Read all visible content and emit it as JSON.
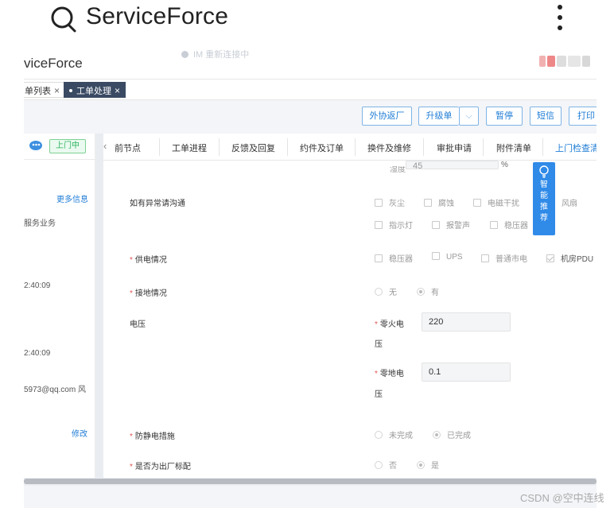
{
  "phone_header": {
    "title": "ServiceForce"
  },
  "app": {
    "title": "viceForce",
    "im_status": "IM 重新连接中"
  },
  "tabs": [
    {
      "label": "单列表",
      "close": "×"
    },
    {
      "label": "工单处理",
      "close": "×"
    }
  ],
  "toolbar": {
    "outsource": "外协返厂",
    "upgrade": "升级单",
    "upgrade_arrow": "⌵",
    "pause": "暂停",
    "sms": "短信",
    "print": "打印"
  },
  "left_panel": {
    "status": "上门中",
    "more_info": "更多信息",
    "service_type": "服务业务",
    "time1": "2:40:09",
    "time2": "2:40:09",
    "email": "5973@qq.com 风",
    "edit": "修改"
  },
  "nav_tabs": {
    "arrow": "‹",
    "items": [
      "前节点",
      "工单进程",
      "反馈及回复",
      "约件及订单",
      "换件及维修",
      "审批申请",
      "附件清单",
      "上门检查清"
    ]
  },
  "form": {
    "top_partial": {
      "label": "湿度",
      "value": "45",
      "unit": "%"
    },
    "abnormal": {
      "label": "如有异常请沟通",
      "options": [
        "灰尘",
        "腐蚀",
        "电磁干扰",
        "风扇",
        "指示灯",
        "报警声",
        "稳压器"
      ]
    },
    "power": {
      "label": "供电情况",
      "options": [
        "稳压器",
        "UPS",
        "普通市电",
        "机房PDU"
      ]
    },
    "ground": {
      "label": "接地情况",
      "options": [
        "无",
        "有"
      ]
    },
    "voltage": {
      "label": "电压",
      "fields": [
        {
          "label_a": "零火电",
          "label_b": "压",
          "value": "220"
        },
        {
          "label_a": "零地电",
          "label_b": "压",
          "value": "0.1"
        }
      ]
    },
    "antistatic": {
      "label": "防静电措施",
      "options": [
        "未完成",
        "已完成"
      ]
    },
    "factory": {
      "label": "是否为出厂标配",
      "options": [
        "否",
        "是"
      ]
    }
  },
  "smart": {
    "chars": [
      "智",
      "能",
      "推",
      "荐"
    ]
  },
  "watermark": "CSDN @空中连线"
}
